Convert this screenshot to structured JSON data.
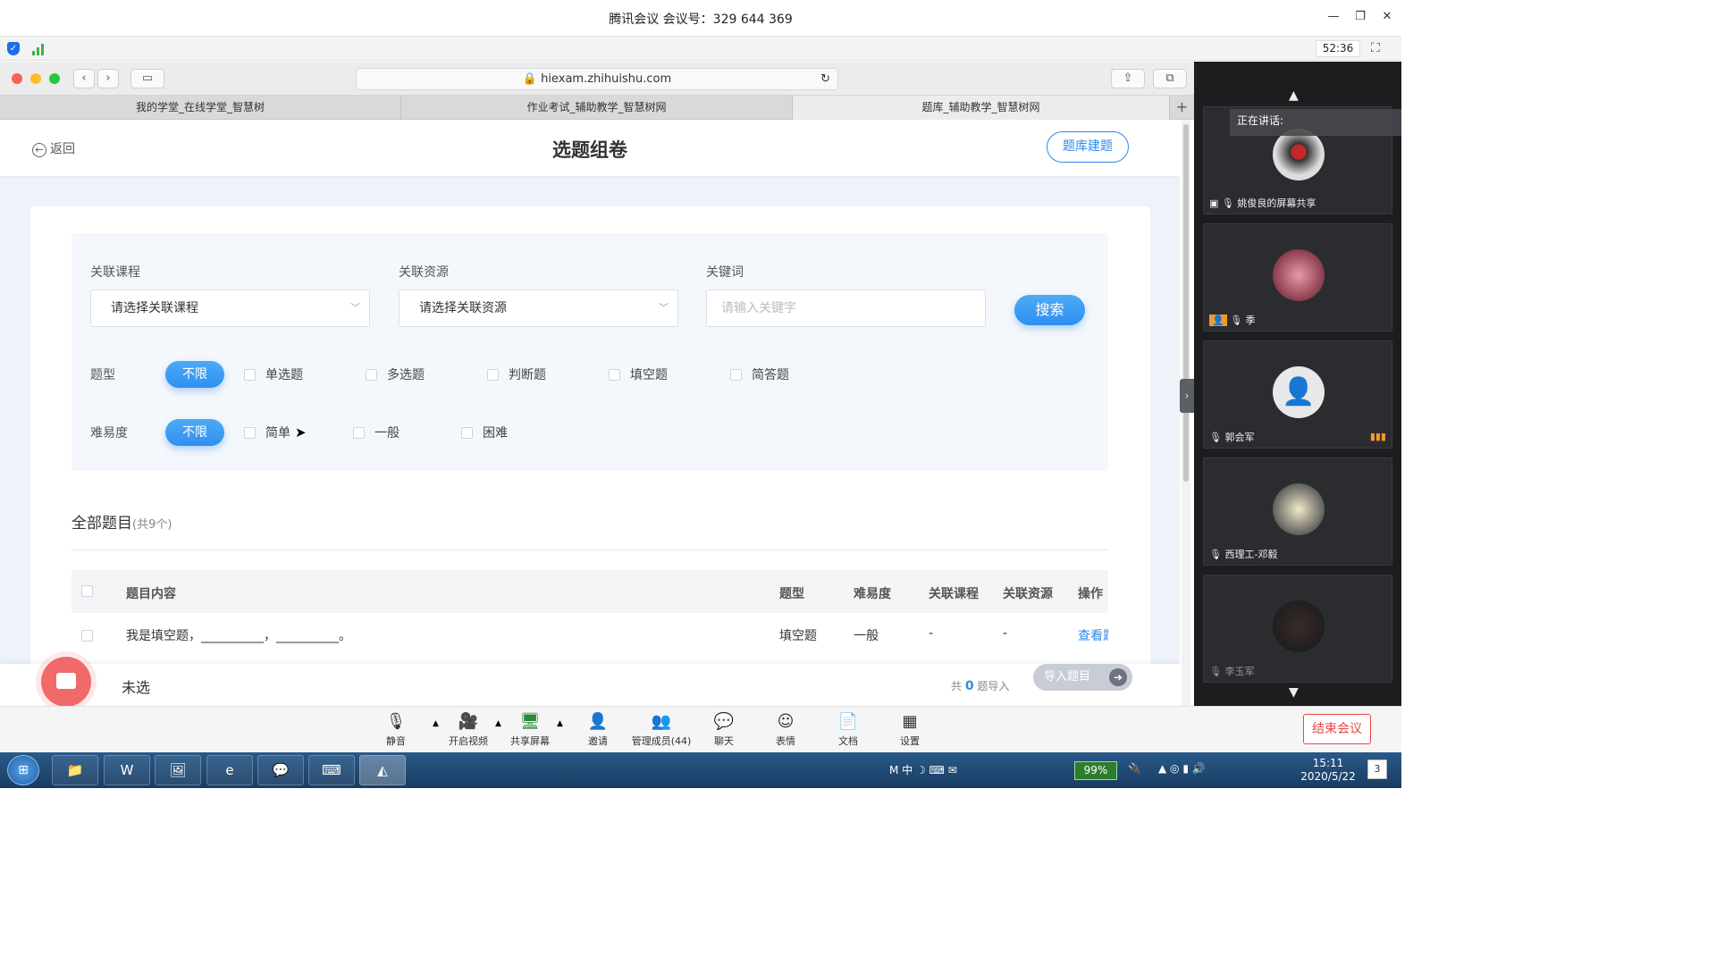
{
  "window": {
    "title": "腾讯会议 会议号：329 644 369",
    "timer": "52:36"
  },
  "browser": {
    "url": "hiexam.zhihuishu.com",
    "tabs": [
      "我的学堂_在线学堂_智慧树",
      "作业考试_辅助教学_智慧树网",
      "题库_辅助教学_智慧树网"
    ]
  },
  "page": {
    "back": "返回",
    "title": "选题组卷",
    "bank_button": "题库建题",
    "filters": {
      "course_label": "关联课程",
      "course_placeholder": "请选择关联课程",
      "resource_label": "关联资源",
      "resource_placeholder": "请选择关联资源",
      "keyword_label": "关键词",
      "keyword_placeholder": "请输入关键字",
      "search": "搜索",
      "type_label": "题型",
      "type_all": "不限",
      "types": [
        "单选题",
        "多选题",
        "判断题",
        "填空题",
        "简答题"
      ],
      "difficulty_label": "难易度",
      "difficulty_all": "不限",
      "difficulties": [
        "简单",
        "一般",
        "困难"
      ]
    },
    "section": {
      "title": "全部题目",
      "count": "(共9个)"
    },
    "table": {
      "headers": [
        "题目内容",
        "题型",
        "难易度",
        "关联课程",
        "关联资源",
        "操作"
      ],
      "rows": [
        {
          "content": "我是填空题，__________，__________。",
          "type": "填空题",
          "difficulty": "一般",
          "course": "-",
          "resource": "-",
          "action": "查看题"
        }
      ]
    },
    "bottom": {
      "unselected": "未选",
      "count_prefix": "共",
      "count": "0",
      "count_suffix": "题导入",
      "import": "导入题目"
    }
  },
  "meeting": {
    "speaking": "正在讲话:",
    "participants": [
      {
        "name": "姚俊良的屏幕共享"
      },
      {
        "name": "季"
      },
      {
        "name": "郭会军"
      },
      {
        "name": "西理工-邓毅"
      },
      {
        "name": "李玉军"
      }
    ],
    "toolbar": [
      "静音",
      "开启视频",
      "共享屏幕",
      "邀请",
      "管理成员(44)",
      "聊天",
      "表情",
      "文档",
      "设置"
    ],
    "end": "结束会议"
  },
  "taskbar": {
    "battery": "99%",
    "time": "15:11",
    "date": "2020/5/22",
    "notifications": "3"
  }
}
